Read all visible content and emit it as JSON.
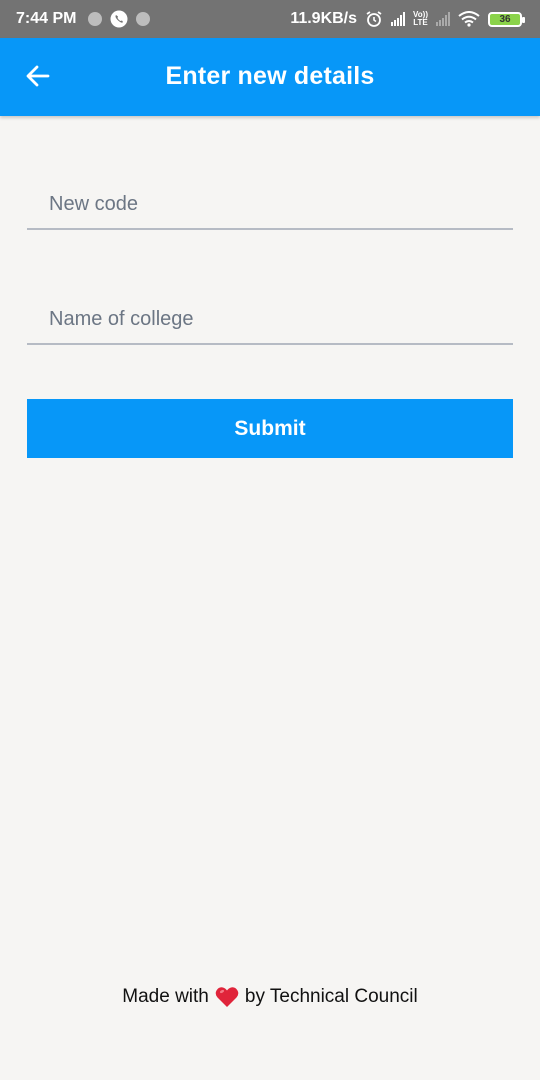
{
  "status_bar": {
    "time": "7:44 PM",
    "network_speed": "11.9KB/s",
    "volte_top": "Vo))",
    "volte_bottom": "LTE",
    "battery_level": "36",
    "icons": [
      "notification-dot-icon",
      "whatsapp-call-icon",
      "notification-dot-icon",
      "alarm-icon",
      "signal-icon",
      "volte-icon",
      "signal-icon",
      "wifi-icon",
      "battery-icon"
    ]
  },
  "app_bar": {
    "title": "Enter new details",
    "back_icon": "arrow-left-icon"
  },
  "form": {
    "code_field": {
      "value": "",
      "placeholder": "New code"
    },
    "college_field": {
      "value": "",
      "placeholder": "Name of college"
    },
    "submit_label": "Submit"
  },
  "footer": {
    "prefix": "Made with",
    "icon": "heart-icon",
    "suffix": "by Technical Council"
  },
  "colors": {
    "primary": "#0797f8",
    "background": "#f6f5f3",
    "status_bar": "#737373",
    "heart": "#e0243a"
  }
}
